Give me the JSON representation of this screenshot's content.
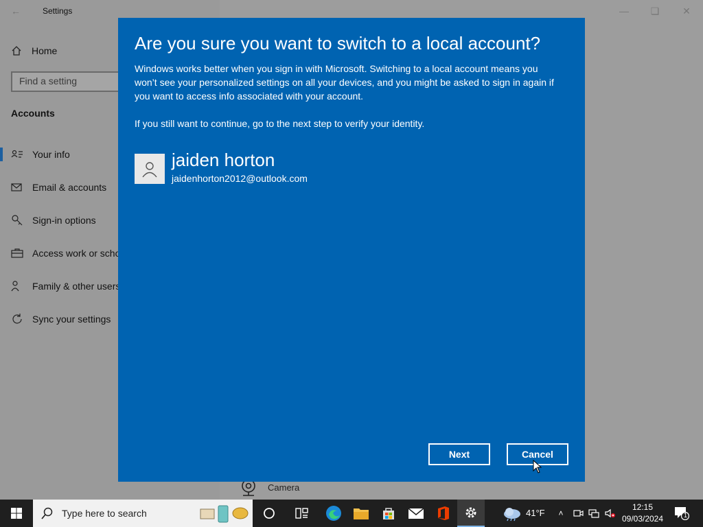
{
  "window": {
    "title": "Settings",
    "back_icon": "back-arrow-icon",
    "controls": [
      "minimize-icon",
      "restore-icon",
      "close-icon"
    ]
  },
  "sidebar": {
    "home_label": "Home",
    "search_placeholder": "Find a setting",
    "section_title": "Accounts",
    "items": [
      {
        "label": "Your info",
        "icon": "person-card-icon",
        "selected": true
      },
      {
        "label": "Email & accounts",
        "icon": "mail-icon",
        "selected": false
      },
      {
        "label": "Sign-in options",
        "icon": "key-icon",
        "selected": false
      },
      {
        "label": "Access work or scho",
        "icon": "briefcase-icon",
        "selected": false
      },
      {
        "label": "Family & other users",
        "icon": "people-icon",
        "selected": false
      },
      {
        "label": "Sync your settings",
        "icon": "sync-icon",
        "selected": false
      }
    ]
  },
  "background_content": {
    "camera_label": "Camera"
  },
  "dialog": {
    "title": "Are you sure you want to switch to a local account?",
    "body": "Windows works better when you sign in with Microsoft. Switching to a local account means you won’t see your personalized settings on all your devices, and you might be asked to sign in again if you want to access info associated with your account.",
    "body2": "If you still want to continue, go to the next step to verify your identity.",
    "account": {
      "name": "jaiden horton",
      "email": "jaidenhorton2012@outlook.com"
    },
    "next_label": "Next",
    "cancel_label": "Cancel",
    "accent_color": "#0063b1"
  },
  "taskbar": {
    "search_placeholder": "Type here to search",
    "pinned": [
      "cortana-icon",
      "task-view-icon",
      "edge-icon",
      "file-explorer-icon",
      "store-icon",
      "mail-icon",
      "office-icon",
      "settings-icon"
    ],
    "active": "settings-icon",
    "weather_temp": "41°F",
    "clock_time": "12:15",
    "clock_date": "09/03/2024",
    "notification_count": "1"
  }
}
